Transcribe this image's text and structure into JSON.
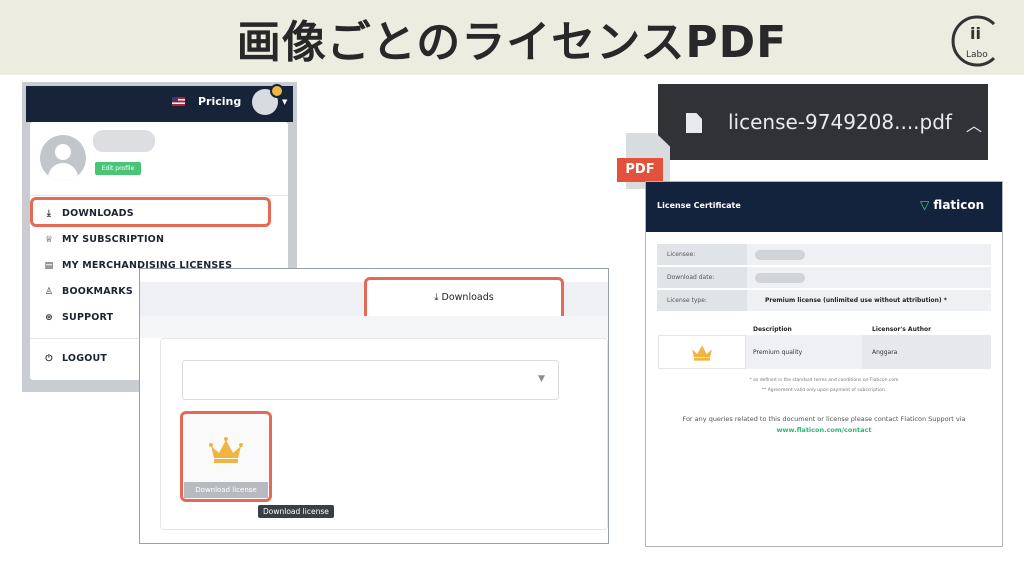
{
  "banner": {
    "title": "画像ごとのライセンスPDF"
  },
  "logo": {
    "glyph": "ii",
    "text": "Labo",
    "ring_color": "#333333"
  },
  "site": {
    "nav": {
      "pricing": "Pricing"
    },
    "menu": {
      "edit_profile": "Edit profile",
      "items": [
        {
          "label": "DOWNLOADS",
          "icon": "download-icon"
        },
        {
          "label": "MY SUBSCRIPTION",
          "icon": "crown-icon"
        },
        {
          "label": "MY MERCHANDISING LICENSES",
          "icon": "license-icon"
        },
        {
          "label": "BOOKMARKS",
          "icon": "bookmark-icon"
        },
        {
          "label": "SUPPORT",
          "icon": "support-icon"
        }
      ],
      "logout": "LOGOUT"
    },
    "downloads": {
      "tab": "Downloads",
      "item_button": "Download license",
      "tooltip": "Download license"
    }
  },
  "chrome": {
    "file_name": "license-9749208....pdf"
  },
  "pdf_badge": "PDF",
  "certificate": {
    "header": "License Certificate",
    "brand": "flaticon",
    "rows": [
      {
        "key": "Licensee:",
        "value": ""
      },
      {
        "key": "Download date:",
        "value": ""
      },
      {
        "key": "License type:",
        "value": "Premium license (unlimited use without attribution) *"
      }
    ],
    "table": {
      "col_description": "Description",
      "col_author": "Licensor's Author",
      "description": "Premium quality",
      "author": "Anggara"
    },
    "note1": "* as defined in the standard terms and conditions on Flaticon.com",
    "note2": "** Agreement valid only upon payment of subscription.",
    "contact": "For any queries related to this document or license please contact Flaticon Support via",
    "contact_link": "www.flaticon.com/contact"
  },
  "colors": {
    "highlight": "#e46a56",
    "navy": "#14233d",
    "accent_green": "#4ac477",
    "crown": "#f0b541"
  }
}
